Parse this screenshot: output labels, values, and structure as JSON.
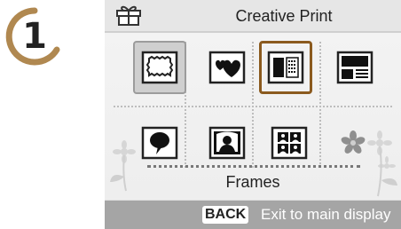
{
  "step": {
    "number": "1"
  },
  "screen": {
    "title": "Creative Print",
    "mode_label": "Frames",
    "footer": {
      "key_label": "BACK",
      "action_label": "Exit to main display"
    }
  },
  "layouts": [
    {
      "name": "frame-layout-icon",
      "state": "selected"
    },
    {
      "name": "hearts-layout-icon",
      "state": "normal"
    },
    {
      "name": "calendar-layout-icon",
      "state": "focused"
    },
    {
      "name": "photo-with-text-layout-icon",
      "state": "normal"
    },
    {
      "name": "speech-bubble-layout-icon",
      "state": "normal"
    },
    {
      "name": "portrait-frame-layout-icon",
      "state": "normal"
    },
    {
      "name": "four-portraits-layout-icon",
      "state": "normal"
    },
    {
      "name": "flower-stamp-icon",
      "state": "normal"
    }
  ],
  "colors": {
    "focus_border": "#8b5a1e",
    "footer_bg": "#a5a5a5",
    "step_ring": "#b08850"
  }
}
